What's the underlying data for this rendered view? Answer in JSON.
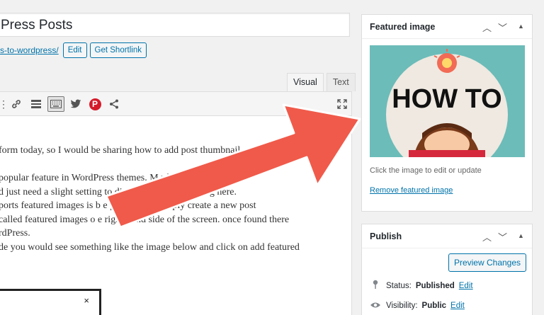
{
  "title": {
    "value": "Press Posts"
  },
  "permalink": {
    "link": "s-to-wordpress/",
    "edit_label": "Edit",
    "shortlink_label": "Get Shortlink"
  },
  "editor": {
    "tabs": [
      {
        "label": "Visual",
        "active": true
      },
      {
        "label": "Text",
        "active": false
      }
    ],
    "toolbar_icons": [
      "list-icon",
      "link-icon",
      "read-more-icon",
      "keyboard-icon",
      "twitter-icon",
      "pinterest-icon",
      "share-icon",
      "fullscreen-icon"
    ],
    "paragraphs": [
      "form today, so I would be sharing how to add post thumbnail",
      "",
      "popular feature in WordPress themes. M                  rdPress themes are",
      "d just need a slight setting to disp                     would be explaining here.",
      "ports featured images is b                   e post editor. Simply create a new post",
      "called featured images o          e right-hand side of the screen. once found there",
      "rdPress.",
      "de you would see something like the image below and click on add featured"
    ],
    "inner_close": "×"
  },
  "featured_image": {
    "title": "Featured image",
    "image_text": "HOW TO",
    "caption": "Click the image to edit or update",
    "remove_label": "Remove featured image"
  },
  "publish": {
    "title": "Publish",
    "preview_label": "Preview Changes",
    "status_label": "Status:",
    "status_value": "Published",
    "status_edit": "Edit",
    "visibility_label": "Visibility:",
    "visibility_value": "Public",
    "visibility_edit": "Edit"
  },
  "colors": {
    "accent": "#0073aa",
    "arrow": "#f05a4a",
    "image_bg": "#6cbcb9"
  }
}
